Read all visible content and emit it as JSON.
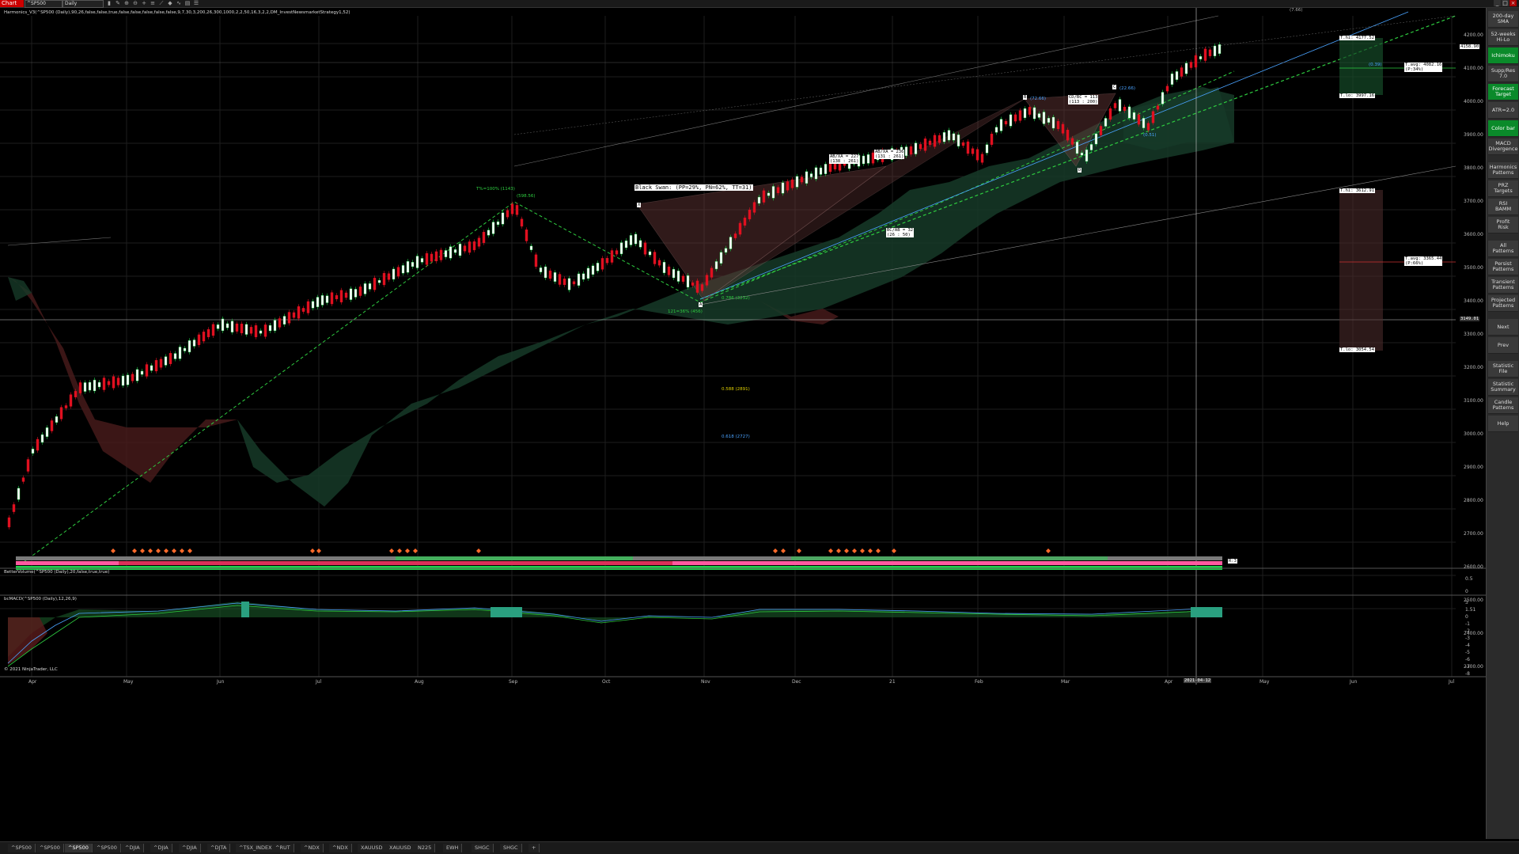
{
  "toolbar": {
    "chart_tab": "Chart",
    "instrument": "^SP500",
    "period": "Daily"
  },
  "main": {
    "indicator_title": "Harmonics_V3(^SP500 (Daily),90,26,false,false,true,false,false,false,false,false,9,7,30,3,200,26,300,1000,2,2,50,16,3,2,2,DM_InvestNewsmarketStrategy1,52)",
    "price_labels": [
      "4200.00",
      "4100.00",
      "4000.00",
      "3900.00",
      "3800.00",
      "3700.00",
      "3600.00",
      "3500.00",
      "3400.00",
      "3300.00",
      "3200.00",
      "3100.00",
      "3000.00",
      "2900.00",
      "2800.00",
      "2700.00",
      "2600.00",
      "2500.00",
      "2400.00",
      "2300.00"
    ],
    "current_price": "4158.90",
    "crosshair_price": "3149.01",
    "annotations": {
      "black_swan": "Black Swan: (PP=29%, PN=62%, TT=31)",
      "ab_xa_1": "AB/XA = 227\n(138 : 261)",
      "ab_xa_2": "AB/XA = 236\n(131 : 261)",
      "cd_bc": "CD/BC = 113\n(113 : 200)",
      "bc_ab": "BC/AB = 32\n(26 : 50)",
      "t_pct_top": "T%=100% (1143)",
      "t_pct_bottom": "121=36% (456)",
      "fib_1": "0.786 (3232)",
      "fib_2": "0.588 (2891)",
      "fib_3": "0.618 (2727)",
      "x_label": "X",
      "a_label": "A",
      "b_label": "B",
      "c_label": "C",
      "d_label": "D",
      "val_1": "(598.56)",
      "val_2": "(72.66)",
      "val_3": "(22.66)",
      "val_4": "(0.51)",
      "val_5": "(0.39)",
      "val_6": "(7.66)",
      "t_hi_top": "T.hi: 4177.52",
      "t_avg_top": "T.avg: 4082.16\n(P:34%)",
      "t_lo_top": "T.lo: 3997.16",
      "t_hi_bot": "T.hi: 3612.91",
      "t_avg_bot": "T.avg: 3365.44\n(P:66%)",
      "t_lo_bot": "T.lo: 3054.54",
      "ratio_tag": "R:3"
    }
  },
  "better_volume": {
    "title": "BetterVolume(^SP500 (Daily),20,false,true,true)",
    "labels": [
      "0.5",
      "0"
    ]
  },
  "macd": {
    "title": "bcMACD(^SP500 (Daily),12,26,9)",
    "labels": [
      "3",
      "1.51",
      "0",
      "-1",
      "-2",
      "-3",
      "-4",
      "-5",
      "-6",
      "-7",
      "-8"
    ]
  },
  "x_axis": {
    "labels": [
      "Apr",
      "May",
      "Jun",
      "Jul",
      "Aug",
      "Sep",
      "Oct",
      "Nov",
      "Dec",
      "21",
      "Feb",
      "Mar",
      "Apr",
      "May",
      "Jun",
      "Jul"
    ],
    "date_marker": "2021-04-12"
  },
  "copyright": "© 2021 NinjaTrader, LLC",
  "sidebar": {
    "buttons": [
      {
        "label": "200-day\nSMA",
        "green": false
      },
      {
        "label": "52-weeks\nHi-Lo",
        "green": false
      },
      {
        "label": "Ichimoku",
        "green": true
      },
      {
        "label": "Supp/Res\n7.0",
        "green": false
      },
      {
        "label": "Forecast\nTarget",
        "green": true
      },
      {
        "label": "ATR=2.0",
        "green": false
      },
      {
        "label": "Color bar",
        "green": true
      },
      {
        "label": "MACD\nDivergence",
        "green": false
      },
      {
        "label": "Harmonics\nPatterns",
        "green": false
      },
      {
        "label": "PRZ\nTargets",
        "green": false
      },
      {
        "label": "RSI\nBAMM",
        "green": false
      },
      {
        "label": "Profit\nRisk",
        "green": false
      },
      {
        "label": "All\nPatterns",
        "green": false
      },
      {
        "label": "Persist\nPatterns",
        "green": false
      },
      {
        "label": "Transient\nPatterns",
        "green": false
      },
      {
        "label": "Projected\nPatterns",
        "green": false
      },
      {
        "label": "Next",
        "green": false
      },
      {
        "label": "Prev",
        "green": false
      },
      {
        "label": "Statistic\nFile",
        "green": false
      },
      {
        "label": "Statistic\nSummary",
        "green": false
      },
      {
        "label": "Candle\nPatterns",
        "green": false
      },
      {
        "label": "Help",
        "green": false
      }
    ]
  },
  "tabs": [
    "^SP500",
    "^SP500",
    "^SP500",
    "^SP500",
    "^DJIA",
    "^DJIA",
    "^DJIA",
    "^DJTA",
    "^TSX_INDEX",
    "^RUT",
    "^NDX",
    "^NDX",
    "XAUUSD",
    "XAUUSD",
    "N225",
    "EWH",
    "SHGC",
    "SHGC",
    "+"
  ],
  "colors": {
    "bull": "#1fd14a",
    "bear": "#e01020",
    "cloud_bull": "#163a28",
    "cloud_bear": "#4a1c1c",
    "accent": "#0a8a2a"
  }
}
